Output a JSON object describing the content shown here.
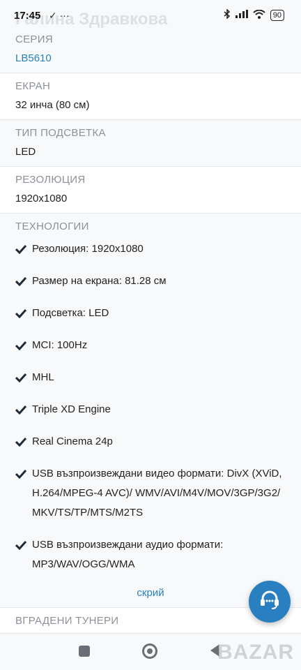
{
  "status": {
    "time": "17:45",
    "battery": "90",
    "ghost_title": "Галина Здравкова"
  },
  "sections": [
    {
      "label": "СЕРИЯ",
      "value": "LB5610"
    },
    {
      "label": "ЕКРАН",
      "value": "32 инча (80 см)"
    },
    {
      "label": "ТИП ПОДСВЕТКА",
      "value": "LED"
    },
    {
      "label": "РЕЗОЛЮЦИЯ",
      "value": "1920x1080"
    }
  ],
  "technologies": {
    "label": "ТЕХНОЛОГИИ",
    "items": [
      "Резолюция: 1920x1080",
      "Размер на екрана: 81.28 см",
      "Подсветка: LED",
      "MCI: 100Hz",
      "MHL",
      "Triple XD Engine",
      "Real Cinema 24p",
      "USB възпроизвеждани видео формати: DivX (XViD, H.264/MPEG-4 AVC)/ WMV/AVI/M4V/MOV/3GP/3G2/ MKV/TS/TP/MTS/M2TS",
      "USB възпроизвеждани аудио формати: MP3/WAV/OGG/WMA"
    ],
    "hide_label": "скрий"
  },
  "next_section": {
    "label": "ВГРАДЕНИ ТУНЕРИ"
  },
  "watermark": "BAZAR",
  "colors": {
    "accent": "#2a7fb8",
    "fab": "#2a7fc1"
  },
  "icons": {
    "check": "check-icon",
    "fab": "headset-icon"
  }
}
